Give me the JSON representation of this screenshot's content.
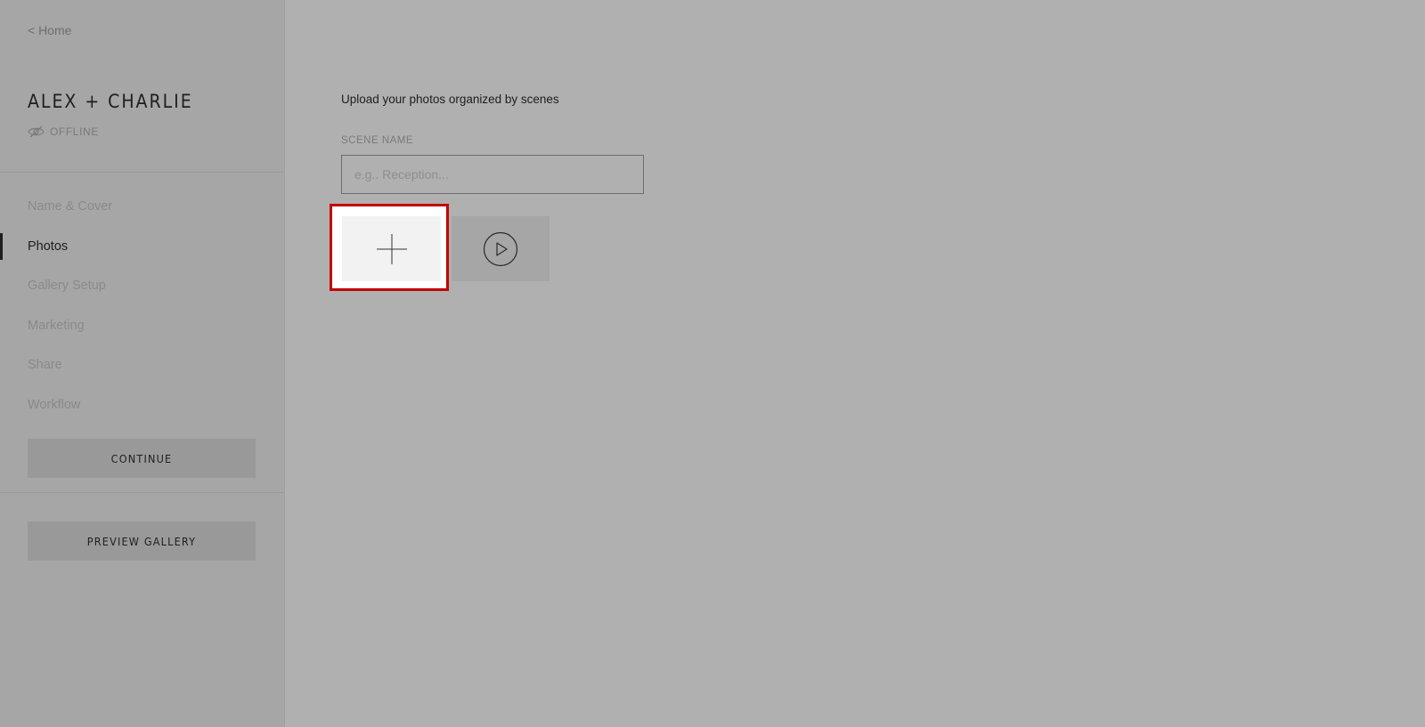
{
  "sidebar": {
    "home_link": "< Home",
    "gallery_title": "ALEX + CHARLIE",
    "status": {
      "label": "OFFLINE",
      "icon": "eye-slash-icon"
    },
    "nav": [
      {
        "label": "Name & Cover",
        "active": false
      },
      {
        "label": "Photos",
        "active": true
      },
      {
        "label": "Gallery Setup",
        "active": false
      },
      {
        "label": "Marketing",
        "active": false
      },
      {
        "label": "Share",
        "active": false
      },
      {
        "label": "Workflow",
        "active": false
      }
    ],
    "continue_label": "CONTINUE",
    "preview_label": "PREVIEW GALLERY"
  },
  "main": {
    "intro": "Upload your photos organized by scenes",
    "scene_name_label": "SCENE NAME",
    "scene_name_placeholder": "e.g.. Reception...",
    "scene_name_value": "",
    "add_tile_icon": "plus-icon",
    "video_tile_icon": "play-circle-icon"
  },
  "colors": {
    "highlight_border": "#c40000",
    "active_indicator": "#1e1e1e",
    "overlay": "#b0b0b0"
  }
}
